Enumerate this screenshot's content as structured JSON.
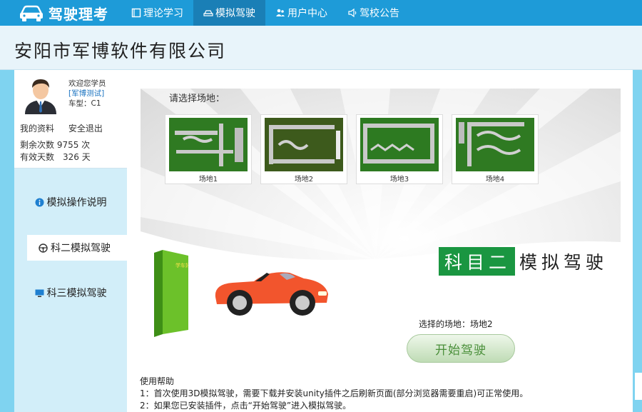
{
  "header": {
    "logo_text": "驾驶理考",
    "nav": [
      {
        "label": "理论学习",
        "icon": "book-icon"
      },
      {
        "label": "模拟驾驶",
        "icon": "car-icon"
      },
      {
        "label": "用户中心",
        "icon": "users-icon"
      },
      {
        "label": "驾校公告",
        "icon": "speaker-icon"
      }
    ],
    "active_nav": 1
  },
  "company": {
    "name": "安阳市军博软件有限公司"
  },
  "sidebar": {
    "welcome": "欢迎您学员",
    "user": "[军博测试]",
    "license_label": "车型：C1",
    "links": [
      "我的资料",
      "安全退出"
    ],
    "remaining": "剩余次数 9755 次",
    "valid_days": "有效天数　326 天",
    "menu": [
      {
        "label": "模拟操作说明",
        "icon": "info-icon"
      },
      {
        "label": "科二模拟驾驶",
        "icon": "steering-wheel-icon"
      },
      {
        "label": "科三模拟驾驶",
        "icon": "monitor-icon"
      }
    ],
    "active_menu": 1
  },
  "main": {
    "select_label": "请选择场地：",
    "sites": [
      "场地1",
      "场地2",
      "场地3",
      "场地4"
    ],
    "subject_green": "科目二",
    "subject_rest": "模拟驾驶",
    "chosen_site": "选择的场地：场地2",
    "start_button": "开始驾驶",
    "box_text": "学车好助手",
    "help_title": "使用帮助",
    "help_lines": [
      "1：首次使用3D模拟驾驶，需要下载并安装unity插件之后刷新页面(部分浏览器需要重启)可正常使用。",
      "2：如果您已安装插件，点击“开始驾驶”进入模拟驾驶。"
    ]
  },
  "colors": {
    "nav_bg": "#1e9bd8",
    "nav_active": "#1a7fb6",
    "page_bg": "#7fd3f0",
    "subject_green": "#1a9641"
  }
}
